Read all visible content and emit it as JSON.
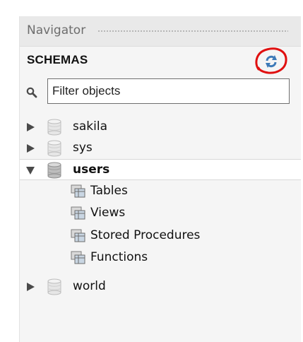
{
  "navigator": {
    "title": "Navigator",
    "section_title": "SCHEMAS",
    "refresh_icon": "refresh-icon",
    "highlight_color": "#e01010",
    "filter": {
      "placeholder": "Filter objects",
      "value": ""
    },
    "schemas": [
      {
        "label": "sakila",
        "expanded": false
      },
      {
        "label": "sys",
        "expanded": false
      },
      {
        "label": "users",
        "expanded": true,
        "selected": true,
        "children": [
          {
            "label": "Tables"
          },
          {
            "label": "Views"
          },
          {
            "label": "Stored Procedures"
          },
          {
            "label": "Functions"
          }
        ]
      },
      {
        "label": "world",
        "expanded": false
      }
    ]
  }
}
